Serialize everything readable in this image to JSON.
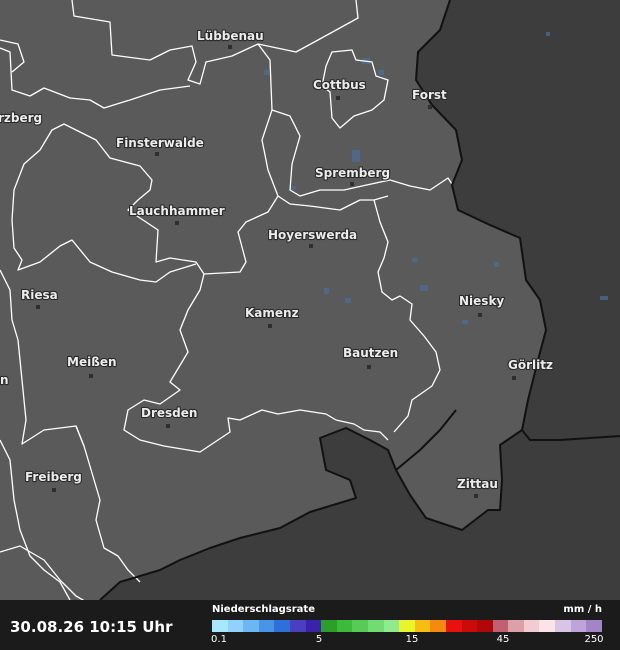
{
  "cities": [
    {
      "name": "Lübbenau"
    },
    {
      "name": "Cottbus"
    },
    {
      "name": "Forst"
    },
    {
      "name": "rzberg"
    },
    {
      "name": "Finsterwalde"
    },
    {
      "name": "Spremberg"
    },
    {
      "name": "Lauchhammer"
    },
    {
      "name": "Hoyerswerda"
    },
    {
      "name": "Riesa"
    },
    {
      "name": "Niesky"
    },
    {
      "name": "Kamenz"
    },
    {
      "name": "Bautzen"
    },
    {
      "name": "Meißen"
    },
    {
      "name": "Görlitz"
    },
    {
      "name": "n"
    },
    {
      "name": "Dresden"
    },
    {
      "name": "Freiberg"
    },
    {
      "name": "Zittau"
    }
  ],
  "footer": {
    "timestamp": "30.08.26 10:15 Uhr",
    "legend_title": "Niederschlagsrate",
    "legend_unit": "mm / h",
    "ticks": [
      "0.1",
      "5",
      "15",
      "45",
      "250"
    ]
  },
  "colors": {
    "background_outside": "#3d3d3d",
    "land": "#5a5a5a",
    "border_internal": "#ffffff",
    "border_national": "#111111",
    "precip_light": "#4a6f9a",
    "legend_scale": [
      "#a8e8ff",
      "#8fd2fb",
      "#6cb6f2",
      "#4894e8",
      "#2f6fd9",
      "#4a3fc0",
      "#3a23a8",
      "#2aa02a",
      "#3cba3c",
      "#56cc56",
      "#72dc72",
      "#90ea90",
      "#e8f52a",
      "#f5be10",
      "#f58a10",
      "#e81010",
      "#cc0a0a",
      "#b00808",
      "#c06070",
      "#dca0a8",
      "#f2ccd2",
      "#fae4e8",
      "#d8c4e4",
      "#bea4d8",
      "#a484c8"
    ]
  }
}
